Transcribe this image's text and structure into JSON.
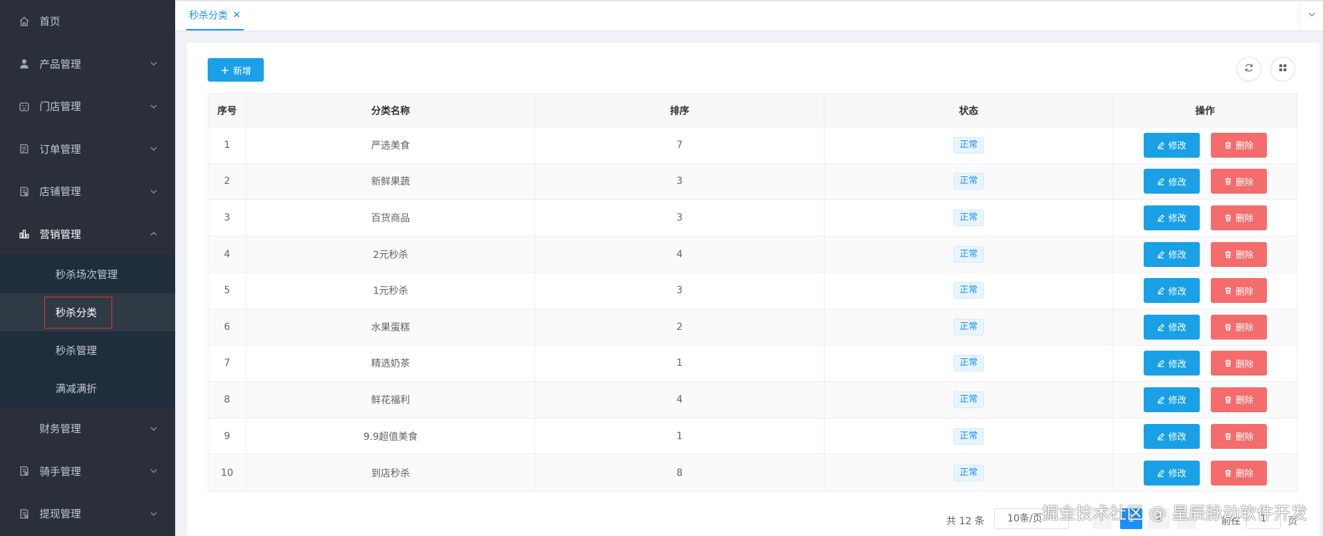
{
  "sidebar": {
    "items": [
      {
        "label": "首页",
        "icon": "home-icon",
        "has_children": false
      },
      {
        "label": "产品管理",
        "icon": "user-icon",
        "has_children": true
      },
      {
        "label": "门店管理",
        "icon": "store-icon",
        "has_children": true
      },
      {
        "label": "订单管理",
        "icon": "order-icon",
        "has_children": true
      },
      {
        "label": "店铺管理",
        "icon": "shop-icon",
        "has_children": true
      },
      {
        "label": "营销管理",
        "icon": "bar-chart-icon",
        "has_children": true,
        "expanded": true
      }
    ],
    "marketing_sub": [
      {
        "label": "秒杀场次管理"
      },
      {
        "label": "秒杀分类",
        "selected": true
      },
      {
        "label": "秒杀管理"
      },
      {
        "label": "满减满折"
      }
    ],
    "items_after": [
      {
        "label": "财务管理",
        "has_children": true
      },
      {
        "label": "骑手管理",
        "icon": "rider-icon",
        "has_children": true
      },
      {
        "label": "提现管理",
        "icon": "withdraw-icon",
        "has_children": true
      }
    ]
  },
  "tabs": [
    {
      "label": "秒杀分类",
      "closable": true
    }
  ],
  "toolbar": {
    "add_label": "新增"
  },
  "table": {
    "columns": [
      "序号",
      "分类名称",
      "排序",
      "状态",
      "操作"
    ],
    "edit_label": "修改",
    "delete_label": "删除",
    "rows": [
      {
        "index": "1",
        "name": "严选美食",
        "sort": "7",
        "status": "正常"
      },
      {
        "index": "2",
        "name": "新鲜果蔬",
        "sort": "3",
        "status": "正常"
      },
      {
        "index": "3",
        "name": "百货商品",
        "sort": "3",
        "status": "正常"
      },
      {
        "index": "4",
        "name": "2元秒杀",
        "sort": "4",
        "status": "正常"
      },
      {
        "index": "5",
        "name": "1元秒杀",
        "sort": "3",
        "status": "正常"
      },
      {
        "index": "6",
        "name": "水果蛋糕",
        "sort": "2",
        "status": "正常"
      },
      {
        "index": "7",
        "name": "精选奶茶",
        "sort": "1",
        "status": "正常"
      },
      {
        "index": "8",
        "name": "鲜花福利",
        "sort": "4",
        "status": "正常"
      },
      {
        "index": "9",
        "name": "9.9超值美食",
        "sort": "1",
        "status": "正常"
      },
      {
        "index": "10",
        "name": "到店秒杀",
        "sort": "8",
        "status": "正常"
      }
    ]
  },
  "pagination": {
    "total_text": "共 12 条",
    "page_size": "10条/页",
    "pages": [
      "1",
      "2"
    ],
    "current_page": "1",
    "goto_prefix": "前往",
    "goto_value": "1",
    "goto_suffix": "页"
  },
  "watermark": "掘金技术社区 @ 星辰脉动软件开发",
  "colors": {
    "primary": "#1aa0e6",
    "danger": "#f56c6c",
    "sidebar_bg": "#2b2f3a",
    "active_tab": "#1890ff"
  }
}
